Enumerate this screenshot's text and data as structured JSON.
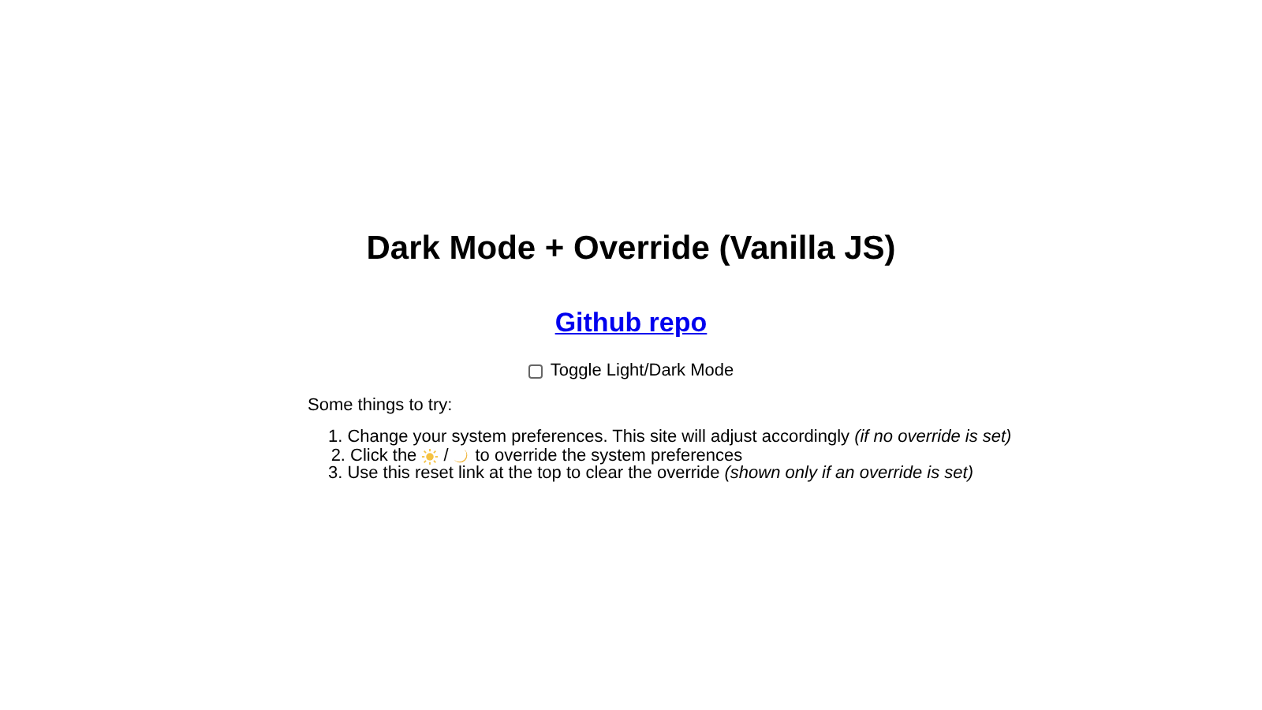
{
  "title": "Dark Mode + Override (Vanilla JS)",
  "link": {
    "label": "Github repo"
  },
  "toggle": {
    "label": "Toggle Light/Dark Mode",
    "checked": false
  },
  "intro": "Some things to try:",
  "steps": [
    {
      "kind": "text",
      "number": "1.",
      "text": "Change your system preferences. This site will adjust accordingly *(if no override is set)*"
    },
    {
      "kind": "icons",
      "number": "2.",
      "before": "Click the",
      "separator": "/",
      "after": "to override the system preferences"
    },
    {
      "kind": "text",
      "number": "3.",
      "text": "Use this reset link at the top to clear the override *(shown only if an override is set)*"
    }
  ]
}
